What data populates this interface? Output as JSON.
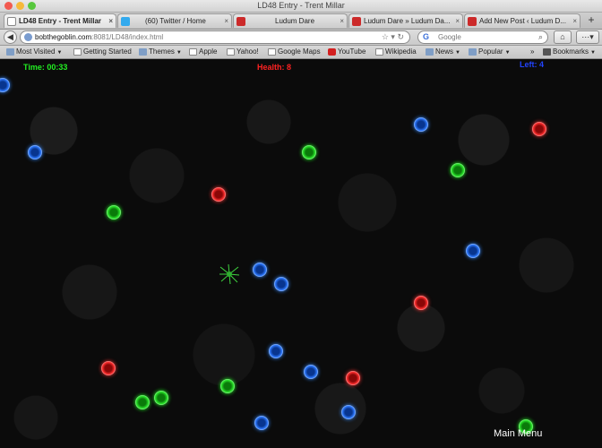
{
  "window": {
    "title": "LD48 Entry - Trent Millar"
  },
  "tabs": [
    {
      "label": "LD48 Entry - Trent Millar",
      "active": true,
      "favicon": "page-icon"
    },
    {
      "label": "(60) Twitter / Home",
      "active": false,
      "favicon": "twitter-icon"
    },
    {
      "label": "Ludum Dare",
      "active": false,
      "favicon": "ludum-dare-icon"
    },
    {
      "label": "Ludum Dare » Ludum Da...",
      "active": false,
      "favicon": "ludum-dare-icon"
    },
    {
      "label": "Add New Post ‹ Ludum D...",
      "active": false,
      "favicon": "ludum-dare-icon"
    }
  ],
  "navbar": {
    "url_host": "bobthegoblin.com",
    "url_rest": ":8081/LD48/index.html",
    "search_placeholder": "Google"
  },
  "bookmarks": [
    {
      "label": "Most Visited",
      "icon": "folder-icon",
      "dropdown": true
    },
    {
      "label": "Getting Started",
      "icon": "page-icon",
      "dropdown": false
    },
    {
      "label": "Themes",
      "icon": "folder-icon",
      "dropdown": true
    },
    {
      "label": "Apple",
      "icon": "page-icon",
      "dropdown": false
    },
    {
      "label": "Yahoo!",
      "icon": "page-icon",
      "dropdown": false
    },
    {
      "label": "Google Maps",
      "icon": "page-icon",
      "dropdown": false
    },
    {
      "label": "YouTube",
      "icon": "youtube-icon",
      "dropdown": false
    },
    {
      "label": "Wikipedia",
      "icon": "page-icon",
      "dropdown": false
    },
    {
      "label": "News",
      "icon": "folder-icon",
      "dropdown": true
    },
    {
      "label": "Popular",
      "icon": "folder-icon",
      "dropdown": true
    },
    {
      "label": "Bookmarks",
      "icon": "bookmarks-icon",
      "dropdown": true
    }
  ],
  "game": {
    "time_label": "Time: 00:33",
    "health_label": "Health: 8",
    "left_label": "Left: 4",
    "menu_label": "Main Menu",
    "colors": {
      "time": "#22ee22",
      "health": "#ff2222",
      "left": "#2244ff",
      "green": "#2ce62c",
      "red": "#ff3030",
      "blue": "#2f7bff"
    }
  }
}
